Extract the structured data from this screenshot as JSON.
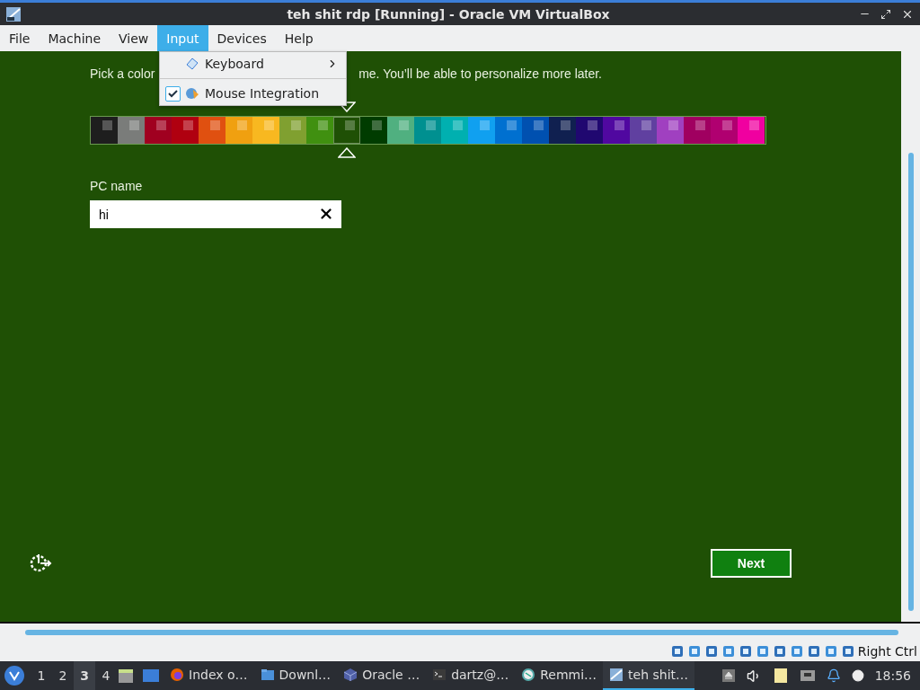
{
  "window": {
    "title": "teh shit rdp [Running] - Oracle VM VirtualBox"
  },
  "menu_bar": [
    {
      "label": "File",
      "selected": false
    },
    {
      "label": "Machine",
      "selected": false
    },
    {
      "label": "View",
      "selected": false
    },
    {
      "label": "Input",
      "selected": true
    },
    {
      "label": "Devices",
      "selected": false
    },
    {
      "label": "Help",
      "selected": false
    }
  ],
  "input_menu": [
    {
      "kind": "submenu",
      "label": "Keyboard"
    },
    {
      "kind": "checkbox",
      "label": "Mouse Integration",
      "checked": true
    }
  ],
  "setup": {
    "prompt_start": "Pick a color",
    "prompt_end": "me. You’ll be able to personalize more later.",
    "swatches": [
      {
        "color": "#1e1e1e",
        "selected": false
      },
      {
        "color": "#7a7c7a",
        "selected": false
      },
      {
        "color": "#a00020",
        "selected": false
      },
      {
        "color": "#b00010",
        "selected": false
      },
      {
        "color": "#e05010",
        "selected": false
      },
      {
        "color": "#f0a010",
        "selected": false
      },
      {
        "color": "#f8b820",
        "selected": false
      },
      {
        "color": "#80a030",
        "selected": false
      },
      {
        "color": "#409010",
        "selected": false
      },
      {
        "color": "#1f5005",
        "selected": true
      },
      {
        "color": "#003c00",
        "selected": false
      },
      {
        "color": "#50b080",
        "selected": false
      },
      {
        "color": "#009090",
        "selected": false
      },
      {
        "color": "#00b0b0",
        "selected": false
      },
      {
        "color": "#10a0f0",
        "selected": false
      },
      {
        "color": "#0070d0",
        "selected": false
      },
      {
        "color": "#0050b0",
        "selected": false
      },
      {
        "color": "#102050",
        "selected": false
      },
      {
        "color": "#200870",
        "selected": false
      },
      {
        "color": "#5008a0",
        "selected": false
      },
      {
        "color": "#6040a0",
        "selected": false
      },
      {
        "color": "#a040c0",
        "selected": false
      },
      {
        "color": "#a00060",
        "selected": false
      },
      {
        "color": "#b00070",
        "selected": false
      },
      {
        "color": "#f000a0",
        "selected": false
      }
    ],
    "pc_name": {
      "label": "PC name",
      "value": "hi"
    },
    "next_button": "Next"
  },
  "vm_status": {
    "host_key": "Right Ctrl"
  },
  "taskbar": {
    "workspaces": [
      {
        "label": "1",
        "selected": false
      },
      {
        "label": "2",
        "selected": false
      },
      {
        "label": "3",
        "selected": true
      },
      {
        "label": "4",
        "selected": false
      }
    ],
    "tasks": [
      {
        "kind": "browser",
        "label": "Index o…",
        "selected": false
      },
      {
        "kind": "folder",
        "label": "Downl…",
        "selected": false
      },
      {
        "kind": "box",
        "label": "Oracle …",
        "selected": false
      },
      {
        "kind": "terminal",
        "label": "dartz@…",
        "selected": false
      },
      {
        "kind": "remote",
        "label": "Remmi…",
        "selected": false
      },
      {
        "kind": "vm",
        "label": "teh shit…",
        "selected": true
      }
    ],
    "clock": "18:56"
  }
}
